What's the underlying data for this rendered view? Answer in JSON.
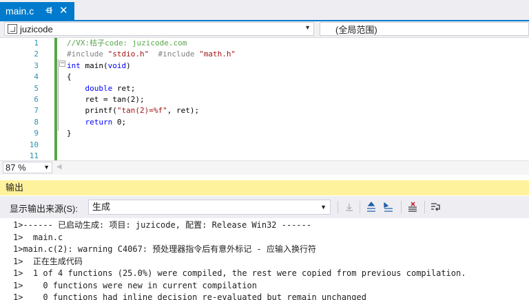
{
  "tab": {
    "title": "main.c",
    "pin_icon": "pin-icon",
    "close_glyph": "✕"
  },
  "navbar": {
    "project": "juzicode",
    "scope": "(全局范围)"
  },
  "editor": {
    "line_numbers": [
      "1",
      "2",
      "3",
      "4",
      "5",
      "6",
      "7",
      "8",
      "9",
      "10",
      "11"
    ],
    "lines": [
      [
        {
          "t": "//VX:桔子code: juzicode.com",
          "c": "c-comment"
        }
      ],
      [
        {
          "t": "#include ",
          "c": "c-pre"
        },
        {
          "t": "\"stdio.h\"",
          "c": "c-str"
        },
        {
          "t": "  #include ",
          "c": "c-pre"
        },
        {
          "t": "\"math.h\"",
          "c": "c-str"
        }
      ],
      [
        {
          "t": "int ",
          "c": "c-kw"
        },
        {
          "t": "main(",
          "c": "c-plain"
        },
        {
          "t": "void",
          "c": "c-kw"
        },
        {
          "t": ")",
          "c": "c-plain"
        }
      ],
      [
        {
          "t": "{",
          "c": "c-plain"
        }
      ],
      [
        {
          "t": "    double ",
          "c": "c-kw"
        },
        {
          "t": "ret;",
          "c": "c-plain"
        }
      ],
      [
        {
          "t": "    ret = tan(2);",
          "c": "c-plain"
        }
      ],
      [
        {
          "t": "    printf(",
          "c": "c-plain"
        },
        {
          "t": "\"tan(2)=%f\"",
          "c": "c-str"
        },
        {
          "t": ", ret);",
          "c": "c-plain"
        }
      ],
      [
        {
          "t": "    return ",
          "c": "c-kw"
        },
        {
          "t": "0;",
          "c": "c-plain"
        }
      ],
      [
        {
          "t": "}",
          "c": "c-plain"
        }
      ],
      [],
      []
    ]
  },
  "zoom": {
    "value": "87 %"
  },
  "output": {
    "title": "输出",
    "source_label": "显示输出来源(S):",
    "source_value": "生成",
    "lines": [
      "1>------ 已启动生成: 项目: juzicode, 配置: Release Win32 ------",
      "1>  main.c",
      "1>main.c(2): warning C4067: 预处理器指令后有意外标记 - 应输入换行符",
      "1>  正在生成代码",
      "1>  1 of 4 functions (25.0%) were compiled, the rest were copied from previous compilation.",
      "1>    0 functions were new in current compilation",
      "1>    0 functions had inline decision re-evaluated but remain unchanged"
    ]
  },
  "colors": {
    "accent": "#007acc",
    "output_header": "#fff29d",
    "highlight": "#e8833a"
  }
}
